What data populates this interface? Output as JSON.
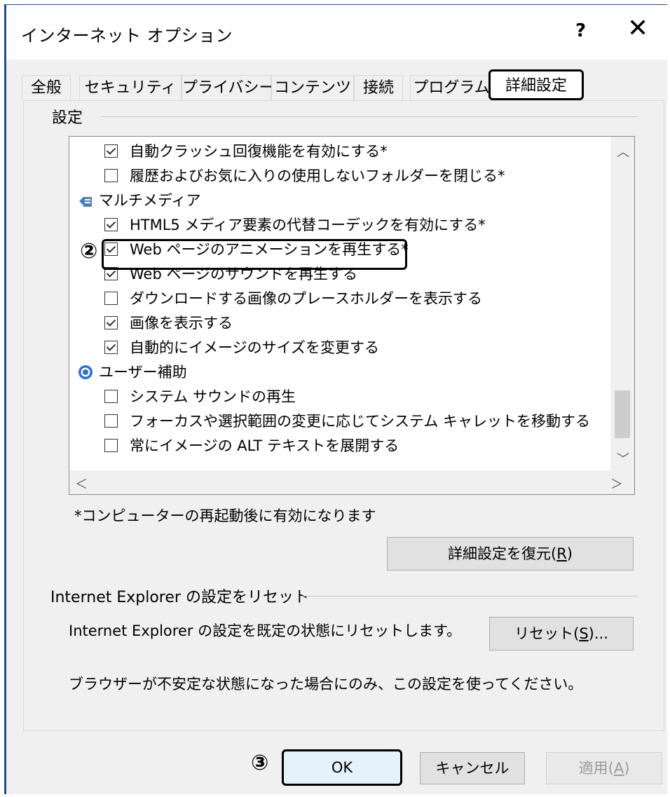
{
  "window": {
    "title": "インターネット オプション",
    "help": "?",
    "close": "✕"
  },
  "tabs": [
    "全般",
    "セキュリティ",
    "プライバシー",
    "コンテンツ",
    "接続",
    "プログラム",
    "詳細設定"
  ],
  "settings_group_label": "設定",
  "list_items": [
    {
      "type": "checkbox",
      "checked": true,
      "label": "自動クラッシュ回復機能を有効にする*"
    },
    {
      "type": "checkbox",
      "checked": false,
      "label": "履歴およびお気に入りの使用しないフォルダーを閉じる*"
    },
    {
      "type": "category",
      "icon": "multimedia-icon",
      "label": "マルチメディア"
    },
    {
      "type": "checkbox",
      "checked": true,
      "label": "HTML5 メディア要素の代替コーデックを有効にする*"
    },
    {
      "type": "checkbox",
      "checked": true,
      "label": "Web ページのアニメーションを再生する*"
    },
    {
      "type": "checkbox",
      "checked": true,
      "label": "Web ページのサウンドを再生する"
    },
    {
      "type": "checkbox",
      "checked": false,
      "label": "ダウンロードする画像のプレースホルダーを表示する"
    },
    {
      "type": "checkbox",
      "checked": true,
      "label": "画像を表示する"
    },
    {
      "type": "checkbox",
      "checked": true,
      "label": "自動的にイメージのサイズを変更する"
    },
    {
      "type": "category",
      "icon": "accessibility-icon",
      "label": "ユーザー補助"
    },
    {
      "type": "checkbox",
      "checked": false,
      "label": "システム サウンドの再生"
    },
    {
      "type": "checkbox",
      "checked": false,
      "label": "フォーカスや選択範囲の変更に応じてシステム キャレットを移動する"
    },
    {
      "type": "checkbox",
      "checked": false,
      "label": "常にイメージの ALT テキストを展開する"
    }
  ],
  "restart_note": "*コンピューターの再起動後に有効になります",
  "restore_button": {
    "text": "詳細設定を復元(",
    "key": "R",
    "suffix": ")"
  },
  "reset_group_label": "Internet Explorer の設定をリセット",
  "reset_desc": "Internet Explorer の設定を既定の状態にリセットします。",
  "reset_button": {
    "text": "リセット(",
    "key": "S",
    "suffix": ")..."
  },
  "reset_note": "ブラウザーが不安定な状態になった場合にのみ、この設定を使ってください。",
  "ok_button": "OK",
  "cancel_button": "キャンセル",
  "apply_button": {
    "text": "適用(",
    "key": "A",
    "suffix": ")"
  },
  "callouts": {
    "step2": "②",
    "step3": "③"
  },
  "colors": {
    "highlight_border": "#000000",
    "window_bg": "#f0f0f0"
  }
}
